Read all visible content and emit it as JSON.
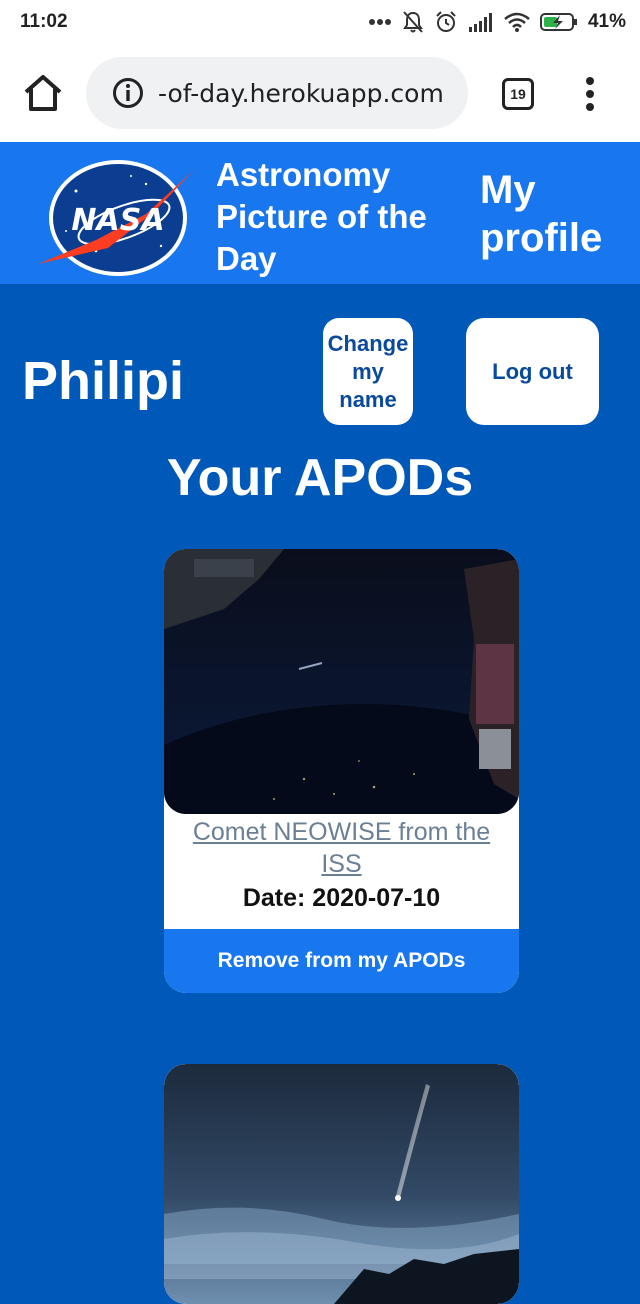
{
  "status_bar": {
    "time": "11:02",
    "battery": "41%",
    "icons": [
      "more-dots-icon",
      "bell-muted-icon",
      "alarm-icon",
      "signal-icon",
      "wifi-icon",
      "battery-charging-icon"
    ]
  },
  "browser": {
    "url": "-of-day.herokuapp.com",
    "tab_count": "19",
    "icons": [
      "home-icon",
      "info-icon",
      "overflow-menu-icon"
    ]
  },
  "header": {
    "logo": "NASA",
    "title": "Astronomy Picture of the Day",
    "profile_link": "My profile",
    "colors": {
      "header_bg": "#1877ee",
      "page_bg": "#0059b8"
    }
  },
  "profile": {
    "name": "Philipi",
    "change_name_label": "Change my name",
    "logout_label": "Log out"
  },
  "apods": {
    "section_title": "Your APODs",
    "items": [
      {
        "title": "Comet NEOWISE from the ISS",
        "date": "Date: 2020-07-10",
        "remove_label": "Remove from my APODs"
      }
    ]
  }
}
